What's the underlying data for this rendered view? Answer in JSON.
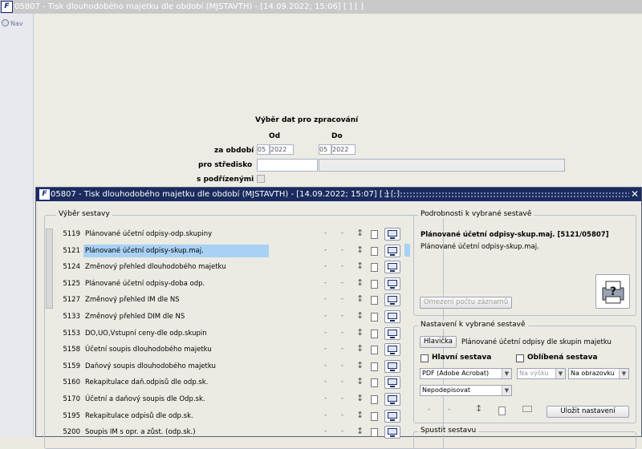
{
  "bg_window": {
    "title": "05807 - Tisk dlouhodobého majetku dle období (MJSTAVTH) - [14.09.2022; 15:06]  [ ]  [ ]",
    "nav_label": "Nav",
    "section_title": "Výběr dat pro zpracování",
    "col_from": "Od",
    "col_to": "Do",
    "period_label": "za období",
    "period_from_month": "05",
    "period_from_year": "2022",
    "period_to_month": "05",
    "period_to_year": "2022",
    "center_label": "pro středisko",
    "subordinates_label": "s podřízenými"
  },
  "dialog": {
    "title": "05807 - Tisk dlouhodobého majetku dle období (MJSTAVTH) - [14.09.2022; 15:07]  [ ]  [ ]",
    "report_group_title": "Výběr sestavy",
    "reports": [
      {
        "code": "5119",
        "name": "Plánované účetní odpisy-odp.skupiny",
        "selected": false
      },
      {
        "code": "5121",
        "name": "Plánované účetní odpisy-skup.maj.",
        "selected": true
      },
      {
        "code": "5124",
        "name": "Změnový přehled dlouhodobého majetku",
        "selected": false
      },
      {
        "code": "5125",
        "name": "Plánované účetní odpisy-doba odp.",
        "selected": false
      },
      {
        "code": "5127",
        "name": "Změnový přehled IM dle NS",
        "selected": false
      },
      {
        "code": "5133",
        "name": "Změnový přehled DIM dle NS",
        "selected": false
      },
      {
        "code": "5153",
        "name": "DO,UO,Vstupní ceny-dle odp.skupin",
        "selected": false
      },
      {
        "code": "5158",
        "name": "Účetní soupis dlouhodobého majetku",
        "selected": false
      },
      {
        "code": "5159",
        "name": "Daňový soupis dlouhodobého majetku",
        "selected": false
      },
      {
        "code": "5160",
        "name": "Rekapitulace daň.odpisů dle odp.sk.",
        "selected": false
      },
      {
        "code": "5170",
        "name": "Účetní a daňový soupis dle Odp.sk.",
        "selected": false
      },
      {
        "code": "5195",
        "name": "Rekapitulace odpisů dle odp.sk.",
        "selected": false
      },
      {
        "code": "5200",
        "name": "Soupis IM s opr. a zůst. (odp.sk.)",
        "selected": false
      }
    ],
    "row_dash": "-",
    "details": {
      "group_title": "Podrobnosti k vybrané sestavě",
      "heading": "Plánované účetní odpisy-skup.maj. [5121/05807]",
      "description": "Plánované účetní odpisy-skup.maj.",
      "limit_button": "Omezení počtu záznamů"
    },
    "settings": {
      "group_title": "Nastavení k vybrané sestavě",
      "header_button": "Hlavička",
      "header_text": "Plánované účetní odpisy dle skupin majetku",
      "main_report_label": "Hlavní sestava",
      "favorite_report_label": "Oblíbená sestava",
      "output_format": "PDF (Adobe Acrobat)",
      "orientation_height": "Na výšku",
      "target": "Na obrazovku",
      "signature": "Nepodepisovat",
      "dash": "-",
      "save_button": "Uložit nastavení"
    },
    "run_group_title": "Spustit sestavu"
  }
}
